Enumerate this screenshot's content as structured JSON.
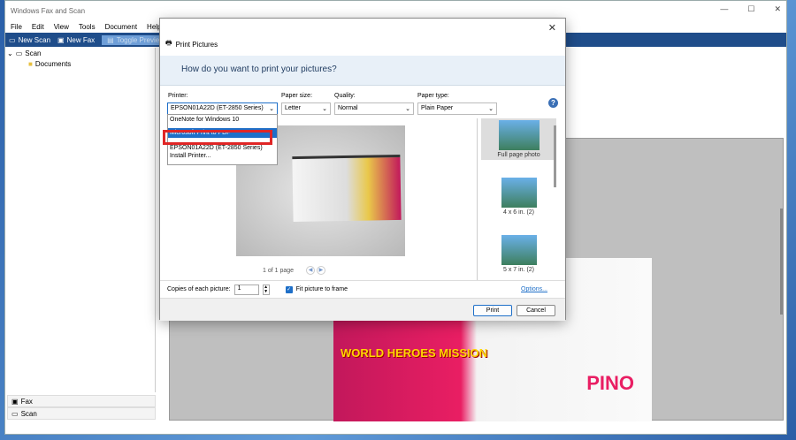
{
  "main_window": {
    "title": "Windows Fax and Scan",
    "menu": [
      "File",
      "Edit",
      "View",
      "Tools",
      "Document",
      "Help"
    ],
    "toolbar": {
      "new_scan": "New Scan",
      "new_fax": "New Fax",
      "toggle_preview": "Toggle Preview"
    },
    "tree": {
      "root": "Scan",
      "child": "Documents"
    },
    "bottom_nav": [
      "Fax",
      "Scan"
    ],
    "preview": {
      "title_art": "WORLD HEROES MISSION",
      "pino": "PINO"
    }
  },
  "dialog": {
    "title": "Print Pictures",
    "header": "How do you want to print your pictures?",
    "printer_label": "Printer:",
    "printer_value": "EPSON01A22D (ET-2850 Series)",
    "paper_size_label": "Paper size:",
    "paper_size_value": "Letter",
    "quality_label": "Quality:",
    "quality_value": "Normal",
    "paper_type_label": "Paper type:",
    "paper_type_value": "Plain Paper",
    "printer_options": [
      "OneNote for Windows 10",
      "Microsoft Print to PDF",
      "EPSON01A22D (ET-2850 Series)",
      "Install Printer..."
    ],
    "page_indicator": "1 of 1 page",
    "layouts": [
      "Full page photo",
      "4 x 6 in. (2)",
      "5 x 7 in. (2)"
    ],
    "copies_label": "Copies of each picture:",
    "copies_value": "1",
    "fit_label": "Fit picture to frame",
    "options_link": "Options...",
    "print_button": "Print",
    "cancel_button": "Cancel",
    "help": "?"
  }
}
